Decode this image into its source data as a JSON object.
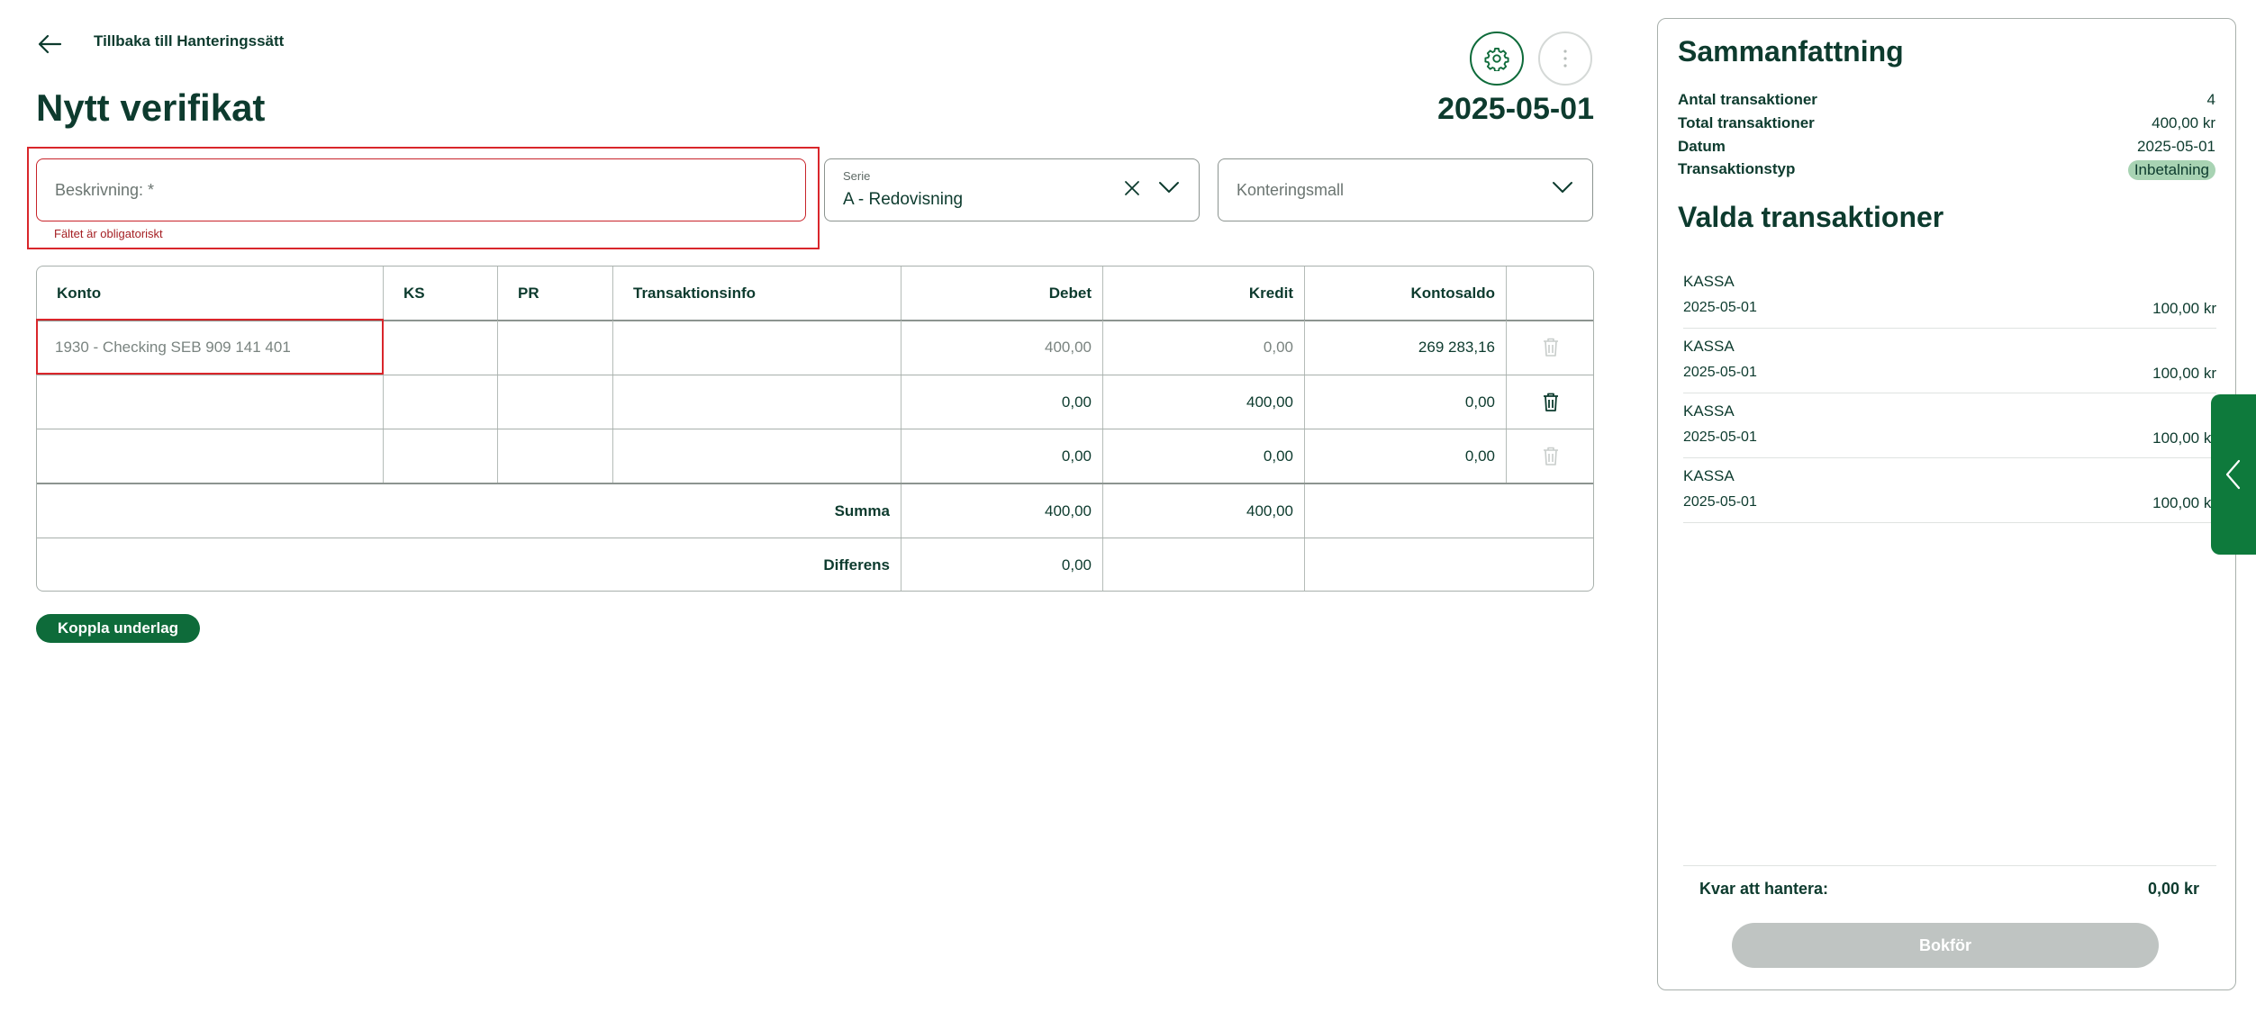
{
  "header": {
    "back_label": "Tillbaka till Hanteringssätt",
    "title": "Nytt verifikat",
    "date": "2025-05-01"
  },
  "icons": {
    "back": "arrow-left-icon",
    "settings": "gear-icon",
    "more": "more-vertical-icon",
    "clear": "close-icon",
    "dropdown": "chevron-down-icon",
    "delete": "trash-icon",
    "panel_toggle": "chevron-left-icon"
  },
  "form": {
    "description_placeholder": "Beskrivning: *",
    "description_error": "Fältet är obligatoriskt",
    "serie_label": "Serie",
    "serie_value": "A - Redovisning",
    "template_placeholder": "Konteringsmall"
  },
  "table": {
    "headers": [
      "Konto",
      "KS",
      "PR",
      "Transaktionsinfo",
      "Debet",
      "Kredit",
      "Kontosaldo"
    ],
    "rows": [
      {
        "konto": "1930 - Checking SEB 909 141 401",
        "ks": "",
        "pr": "",
        "info": "",
        "debet": "400,00",
        "kredit": "0,00",
        "saldo": "269 283,16"
      },
      {
        "konto": "",
        "ks": "",
        "pr": "",
        "info": "",
        "debet": "0,00",
        "kredit": "400,00",
        "saldo": "0,00"
      },
      {
        "konto": "",
        "ks": "",
        "pr": "",
        "info": "",
        "debet": "0,00",
        "kredit": "0,00",
        "saldo": "0,00"
      }
    ],
    "summa_label": "Summa",
    "summa_debet": "400,00",
    "summa_kredit": "400,00",
    "differens_label": "Differens",
    "differens_value": "0,00"
  },
  "koppla_label": "Koppla underlag",
  "summary": {
    "title": "Sammanfattning",
    "rows": [
      {
        "label": "Antal transaktioner",
        "value": "4"
      },
      {
        "label": "Total transaktioner",
        "value": "400,00 kr"
      },
      {
        "label": "Datum",
        "value": "2025-05-01"
      },
      {
        "label": "Transaktionstyp",
        "value": "Inbetalning"
      }
    ],
    "selected_title": "Valda transaktioner",
    "transactions": [
      {
        "name": "KASSA",
        "date": "2025-05-01",
        "amount": "100,00 kr"
      },
      {
        "name": "KASSA",
        "date": "2025-05-01",
        "amount": "100,00 kr"
      },
      {
        "name": "KASSA",
        "date": "2025-05-01",
        "amount": "100,00 kr"
      },
      {
        "name": "KASSA",
        "date": "2025-05-01",
        "amount": "100,00 kr"
      }
    ],
    "remaining_label": "Kvar att hantera:",
    "remaining_value": "0,00 kr",
    "book_label": "Bokför"
  },
  "colors": {
    "brand_green": "#0e6b3a",
    "dark_text": "#0d3b2e",
    "error_red": "#d9262b",
    "badge_bg": "#a8d3b3",
    "disabled_button": "#bfc4c2"
  }
}
